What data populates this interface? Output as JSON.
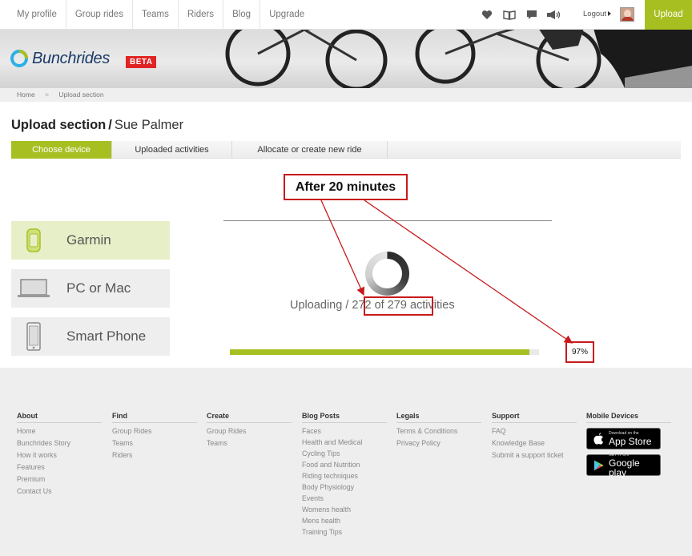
{
  "nav": {
    "items": [
      "My profile",
      "Group rides",
      "Teams",
      "Riders",
      "Blog",
      "Upgrade"
    ],
    "logout": "Logout",
    "upload": "Upload"
  },
  "brand": {
    "name": "Bunchrides",
    "badge": "BETA",
    "color": "#1b3a68"
  },
  "breadcrumb": {
    "home": "Home",
    "current": "Upload section"
  },
  "page": {
    "title": "Upload section",
    "user": "Sue Palmer"
  },
  "tabs": [
    "Choose device",
    "Uploaded activities",
    "Allocate or create new ride"
  ],
  "devices": [
    "Garmin",
    "PC or Mac",
    "Smart Phone"
  ],
  "upload": {
    "prefix": "Uploading / ",
    "count": "272 of 279",
    "suffix": " activities",
    "progress_percent": 97
  },
  "annotations": {
    "label": "After 20 minutes",
    "percent": "97%"
  },
  "footer": {
    "columns": [
      {
        "title": "About",
        "links": [
          "Home",
          "Bunchrides Story",
          "How it works",
          "Features",
          "Premium",
          "Contact Us"
        ]
      },
      {
        "title": "Find",
        "links": [
          "Group Rides",
          "Teams",
          "Riders"
        ]
      },
      {
        "title": "Create",
        "links": [
          "Group Rides",
          "Teams"
        ]
      },
      {
        "title": "Blog Posts",
        "links": [
          "Faces",
          "Health and Medical",
          "Cycling Tips",
          "Food and Nutrition",
          "Riding techniques",
          "Body Physiology",
          "Events",
          "Womens health",
          "Mens health",
          "Training Tips"
        ]
      },
      {
        "title": "Legals",
        "links": [
          "Terms & Conditions",
          "Privacy Policy"
        ]
      },
      {
        "title": "Support",
        "links": [
          "FAQ",
          "Knowledge Base",
          "Submit a support ticket"
        ]
      }
    ],
    "mobile": {
      "title": "Mobile Devices",
      "appstore_small": "Download on the",
      "appstore_big": "App Store",
      "googleplay_small": "GET IT ON",
      "googleplay_big": "Google play"
    }
  },
  "colors": {
    "accent": "#a8bf22",
    "annotation": "#c8191c",
    "beta": "#e02424"
  }
}
